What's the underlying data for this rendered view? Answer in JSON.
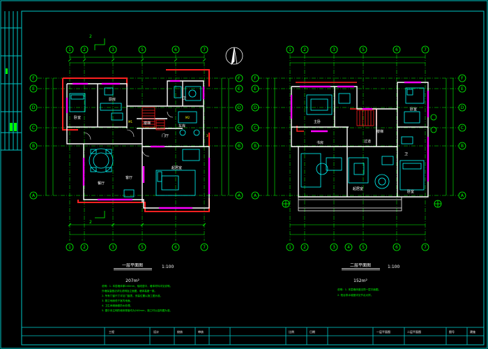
{
  "colors": {
    "background": "#000000",
    "frame": "#00c8c8",
    "wall": "#ffffff",
    "axis": "#00ff00",
    "dimension": "#00ff00",
    "furniture": "#00ffff",
    "window": "#ff00ff",
    "hatch": "#ff2020",
    "text": "#ffffff",
    "notes": "#00ff00",
    "stairs": "#ff2020"
  },
  "plan1": {
    "axes_top": [
      "1",
      "2",
      "3",
      "5",
      "6",
      "7"
    ],
    "axes_bottom": [
      "1",
      "2",
      "3",
      "5",
      "6",
      "7"
    ],
    "axes_left": [
      "F",
      "E",
      "D",
      "C",
      "B",
      "A"
    ],
    "axes_right": [
      "F",
      "E",
      "D",
      "C",
      "B",
      "A"
    ],
    "section_mark": "2",
    "title": "一层平面图",
    "scale": "1:100",
    "area": "207m²",
    "notes": [
      "说明：1. 本层墙体厚240mm，轴线居中，墙体材料详见说明。",
      "   外墙保温做法详见说明及立面图，墙体高度一致。",
      "2. 所有门窗尺寸详见门窗表，安装位置以施工图为准。",
      "3. 厨卫地面低于室内地面。",
      "4. 卫生间墙面做防水处理。",
      "5. 图中未注明的墙体厚度均为240mm，施工时以结构图为准。"
    ]
  },
  "plan2": {
    "axes_top": [
      "1",
      "2",
      "3",
      "5",
      "6",
      "7"
    ],
    "axes_bottom": [
      "1",
      "2",
      "3",
      "4",
      "5",
      "6",
      "7"
    ],
    "axes_left": [
      "F",
      "E",
      "D",
      "C",
      "B",
      "A"
    ],
    "axes_right": [
      "F",
      "E",
      "D",
      "C",
      "B",
      "A"
    ],
    "title": "二层平面图",
    "scale": "1:100",
    "area": "152m²",
    "notes": [
      "说明：1. 本层墙体做法同一层平面图。",
      "2. 阳台排水坡度详见节点大样。"
    ]
  },
  "title_block": {
    "labels": [
      "工程",
      "设计",
      "校核",
      "审核",
      "比例",
      "日期",
      "一层平面图",
      "图号"
    ],
    "values": [
      "",
      "",
      "",
      "",
      "",
      "",
      "二层平面图",
      "建施"
    ]
  }
}
